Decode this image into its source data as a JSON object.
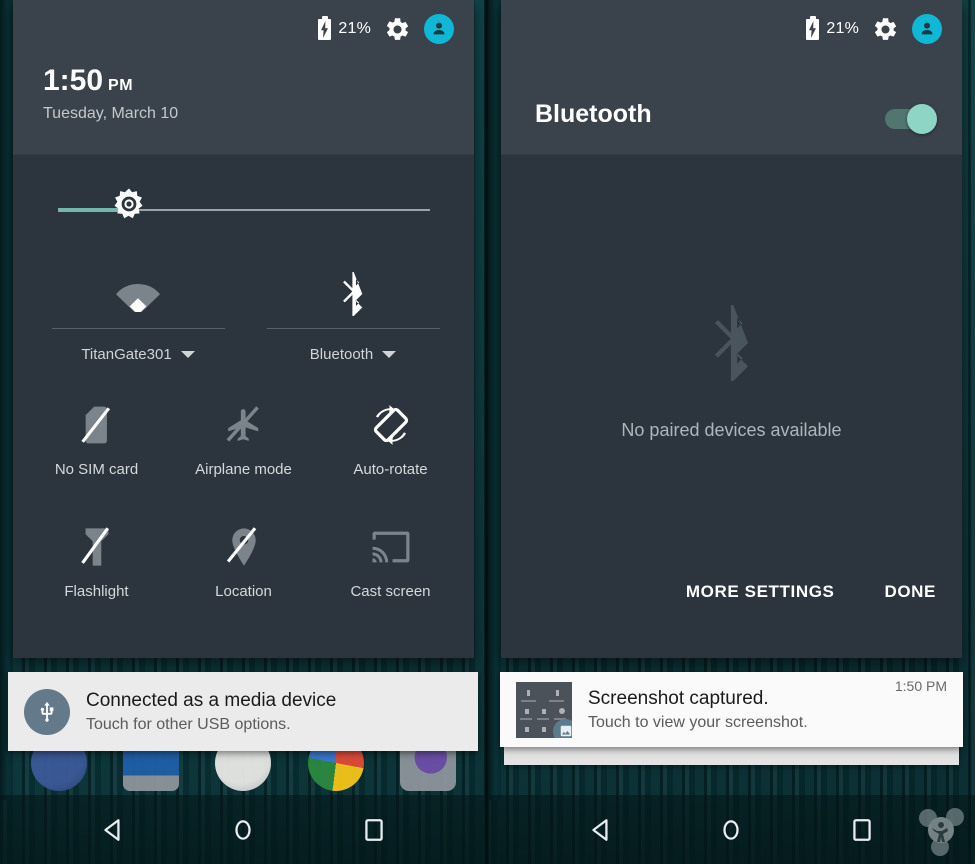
{
  "colors": {
    "shade_bg": "#2c353d",
    "shade_header_bg": "#3a434b",
    "accent_cyan": "#0fb8d4",
    "accent_teal": "#76b5ad",
    "toggle_thumb": "#8fd5c6",
    "wallpaper": "#0a3a3e"
  },
  "statusbar": {
    "battery_percent": "21%",
    "battery_icon": "battery-charging-icon",
    "settings_icon": "gear-icon",
    "avatar_icon": "user-avatar-icon"
  },
  "left_panel": {
    "clock": {
      "time": "1:50",
      "ampm": "PM",
      "date": "Tuesday, March 10"
    },
    "brightness": {
      "icon": "brightness-icon",
      "value_percent": 16
    },
    "dual_tiles": [
      {
        "label": "TitanGate301",
        "icon": "wifi-icon",
        "caret": "chevron-down-icon"
      },
      {
        "label": "Bluetooth",
        "icon": "bluetooth-icon",
        "caret": "chevron-down-icon"
      }
    ],
    "tiles": [
      {
        "label": "No SIM card",
        "icon": "sim-card-off-icon"
      },
      {
        "label": "Airplane mode",
        "icon": "airplane-icon"
      },
      {
        "label": "Auto-rotate",
        "icon": "auto-rotate-icon"
      },
      {
        "label": "Flashlight",
        "icon": "flashlight-off-icon"
      },
      {
        "label": "Location",
        "icon": "location-off-icon"
      },
      {
        "label": "Cast screen",
        "icon": "cast-screen-icon"
      }
    ],
    "notification": {
      "icon": "usb-icon",
      "title": "Connected as a media device",
      "subtitle": "Touch for other USB options."
    }
  },
  "right_panel": {
    "title": "Bluetooth",
    "toggle": {
      "name": "bluetooth-toggle",
      "state": "on"
    },
    "empty_state": {
      "icon": "bluetooth-icon",
      "message": "No paired devices available"
    },
    "actions": [
      {
        "label": "MORE SETTINGS"
      },
      {
        "label": "DONE"
      }
    ],
    "notification": {
      "icon": "screenshot-thumbnail",
      "badge": "image-icon",
      "title": "Screenshot captured.",
      "subtitle": "Touch to view your screenshot.",
      "time": "1:50 PM"
    }
  },
  "navbar": {
    "buttons": [
      {
        "name": "back-button",
        "icon": "back-triangle-icon"
      },
      {
        "name": "home-button",
        "icon": "home-circle-icon"
      },
      {
        "name": "recents-button",
        "icon": "recents-square-icon"
      }
    ]
  },
  "watermark": {
    "icon": "app-logo-watermark"
  }
}
